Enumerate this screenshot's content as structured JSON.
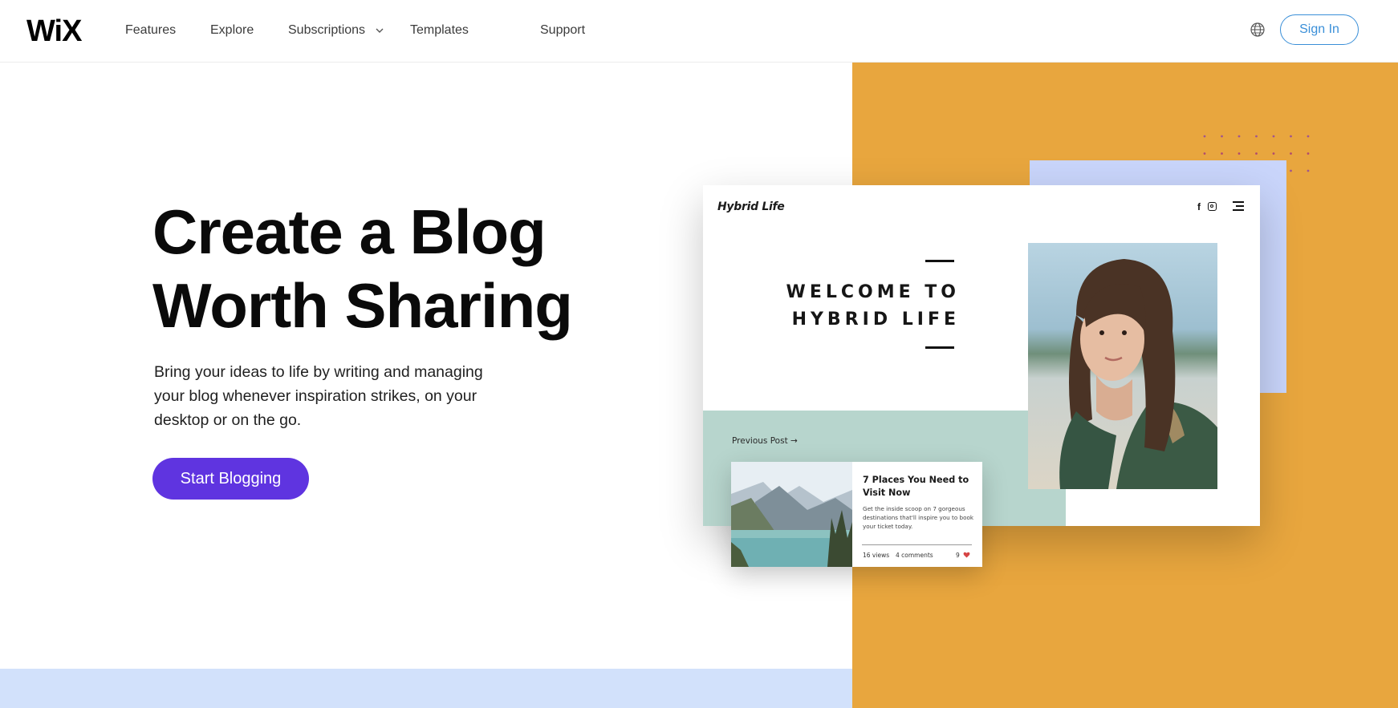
{
  "header": {
    "logo": "WiX",
    "nav": [
      "Features",
      "Explore",
      "Subscriptions",
      "Templates",
      "Support"
    ],
    "sign_in": "Sign In",
    "icons": [
      "chevron-down-icon",
      "globe-icon"
    ]
  },
  "hero": {
    "title_line1": "Create a Blog",
    "title_line2": "Worth Sharing",
    "subtitle": "Bring your ideas to life by writing and managing your blog whenever inspiration strikes, on your desktop or on the go.",
    "cta": "Start Blogging"
  },
  "mockup": {
    "site_name": "Hybrid Life",
    "social_icons": [
      "facebook-icon",
      "instagram-icon",
      "menu-icon"
    ],
    "welcome_line1": "WELCOME TO",
    "welcome_line2": "HYBRID LIFE",
    "previous_post": "Previous Post →",
    "post": {
      "title": "7 Places You Need to Visit Now",
      "description": "Get the inside scoop on 7 gorgeous destinations that'll inspire you to book your ticket today.",
      "views": "16 views",
      "comments": "4 comments",
      "likes": "9"
    }
  },
  "colors": {
    "accent_purple": "#5f34e0",
    "orange": "#e8a63e",
    "light_blue": "#d2e1fb",
    "lavender": "#c9d5fb",
    "mint": "#b7d5cd",
    "sign_in_blue": "#3a8fd8"
  }
}
